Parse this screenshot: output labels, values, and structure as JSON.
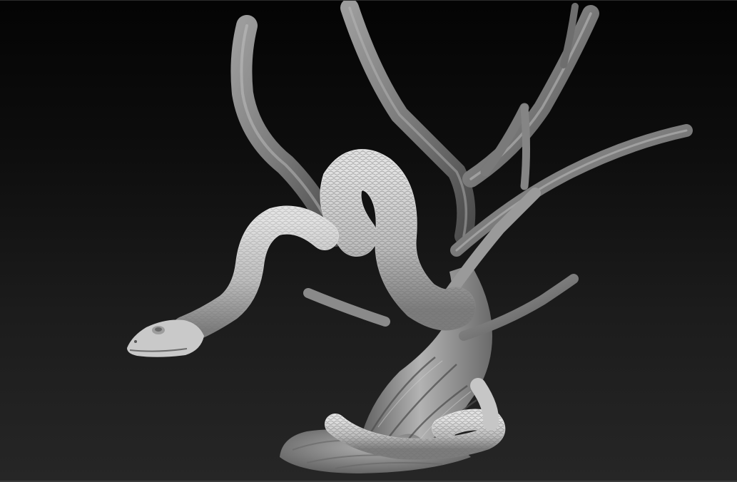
{
  "canvas": {
    "background_top": "#040404",
    "background_bottom": "#262626",
    "material_color": "#b9b9b9"
  },
  "model": {
    "subject": "snake-on-tree-sculpt"
  }
}
